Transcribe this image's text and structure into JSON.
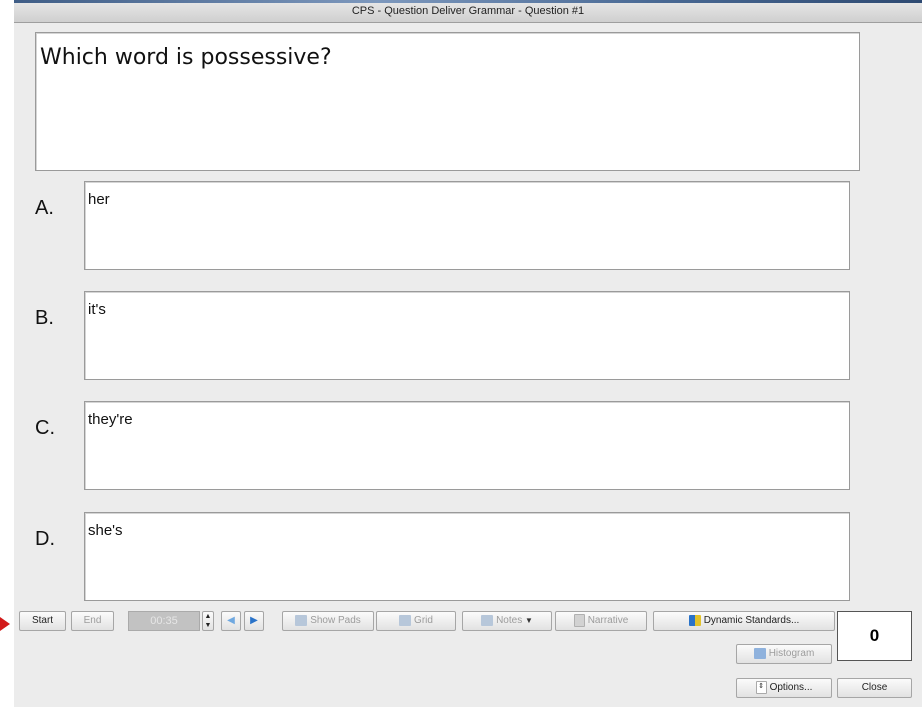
{
  "window": {
    "title": "CPS - Question Deliver Grammar - Question #1"
  },
  "question": {
    "text": "Which word is possessive?"
  },
  "answers": [
    {
      "letter": "A.",
      "text": "her"
    },
    {
      "letter": "B.",
      "text": "it's"
    },
    {
      "letter": "C.",
      "text": "they're"
    },
    {
      "letter": "D.",
      "text": "she's"
    }
  ],
  "toolbar": {
    "start_label": "Start",
    "end_label": "End",
    "timer_value": "00:35",
    "show_pads_label": "Show Pads",
    "grid_label": "Grid",
    "notes_label": "Notes",
    "narrative_label": "Narrative",
    "dynamic_standards_label": "Dynamic Standards...",
    "histogram_label": "Histogram",
    "options_label": "Options...",
    "close_label": "Close"
  },
  "response_count": "0",
  "colors": {
    "pointer_arrow": "#d21a1a",
    "play_button": "#2a73c9"
  }
}
